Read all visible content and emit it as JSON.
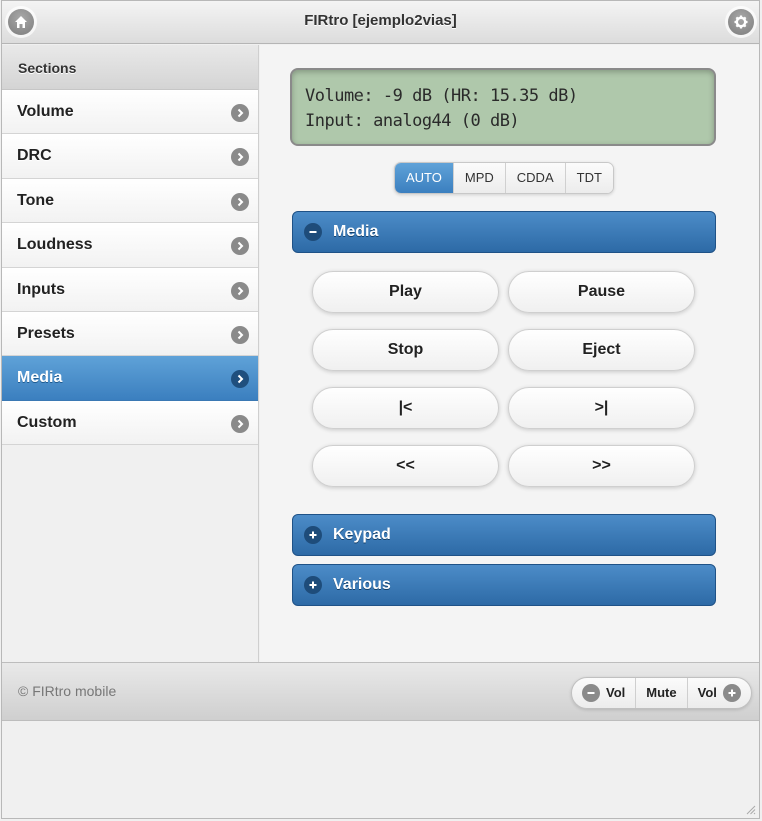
{
  "header": {
    "title": "FIRtro [ejemplo2vias]",
    "left_icon": "home-icon",
    "right_icon": "gear-icon"
  },
  "sidebar": {
    "heading": "Sections",
    "items": [
      {
        "label": "Volume",
        "active": false
      },
      {
        "label": "DRC",
        "active": false
      },
      {
        "label": "Tone",
        "active": false
      },
      {
        "label": "Loudness",
        "active": false
      },
      {
        "label": "Inputs",
        "active": false
      },
      {
        "label": "Presets",
        "active": false
      },
      {
        "label": "Media",
        "active": true
      },
      {
        "label": "Custom",
        "active": false
      }
    ]
  },
  "display": {
    "line1": "Volume: -9 dB (HR: 15.35 dB)",
    "line2": "Input: analog44 (0 dB)"
  },
  "source_tabs": [
    {
      "label": "AUTO",
      "active": true
    },
    {
      "label": "MPD",
      "active": false
    },
    {
      "label": "CDDA",
      "active": false
    },
    {
      "label": "TDT",
      "active": false
    }
  ],
  "sections": {
    "media": {
      "label": "Media",
      "expanded": true
    },
    "keypad": {
      "label": "Keypad",
      "expanded": false
    },
    "various": {
      "label": "Various",
      "expanded": false
    }
  },
  "media_buttons": [
    "Play",
    "Pause",
    "Stop",
    "Eject",
    "|<",
    ">|",
    "<<",
    ">>"
  ],
  "footer": {
    "copyright": "© FIRtro mobile",
    "vol_down": "Vol",
    "mute": "Mute",
    "vol_up": "Vol"
  },
  "colors": {
    "accent": "#3b7fbf",
    "lcd": "#afc8ab"
  }
}
